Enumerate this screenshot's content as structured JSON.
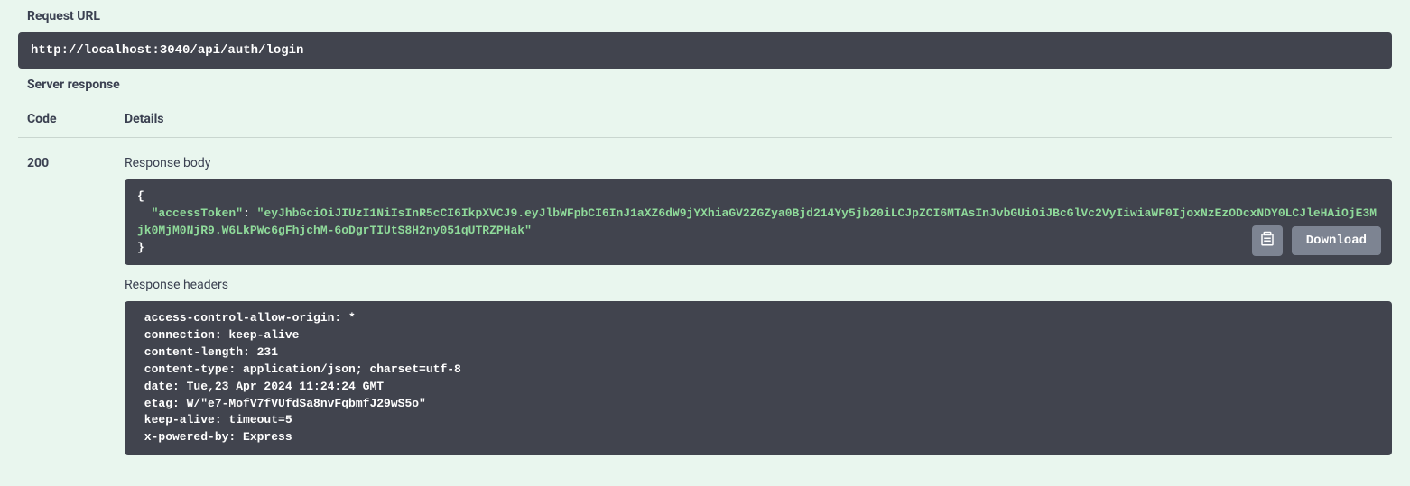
{
  "request": {
    "url_label": "Request URL",
    "url": "http://localhost:3040/api/auth/login"
  },
  "server_response_label": "Server response",
  "columns": {
    "code": "Code",
    "details": "Details"
  },
  "response": {
    "status_code": "200",
    "body_label": "Response body",
    "body_key": "\"accessToken\"",
    "body_value": "\"eyJhbGciOiJIUzI1NiIsInR5cCI6IkpXVCJ9.eyJlbWFpbCI6InJ1aXZ6dW9jYXhiaGV2ZGZya0Bjd214Yy5jb20iLCJpZCI6MTAsInJvbGUiOiJBcGlVc2VyIiwiaWF0IjoxNzEzODcxNDY0LCJleHAiOjE3Mjk0MjM0NjR9.W6LkPWc6gFhjchM-6oDgrTIUtS8H2ny051qUTRZPHak\"",
    "headers_label": "Response headers",
    "headers_text": " access-control-allow-origin: * \n connection: keep-alive \n content-length: 231 \n content-type: application/json; charset=utf-8 \n date: Tue,23 Apr 2024 11:24:24 GMT \n etag: W/\"e7-MofV7fVUfdSa8nvFqbmfJ29wS5o\" \n keep-alive: timeout=5 \n x-powered-by: Express "
  },
  "buttons": {
    "download": "Download"
  }
}
